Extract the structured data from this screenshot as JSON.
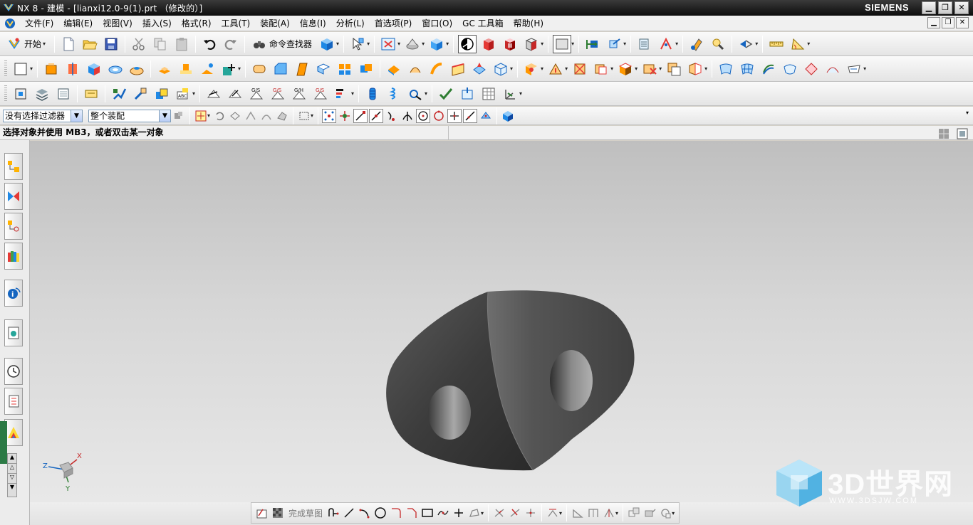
{
  "window": {
    "title": "NX 8 - 建模 - [lianxi12.0-9(1).prt （修改的）]",
    "brand": "SIEMENS",
    "controls": [
      "minimize",
      "restore",
      "close"
    ]
  },
  "menu": {
    "items": [
      "文件(F)",
      "编辑(E)",
      "视图(V)",
      "插入(S)",
      "格式(R)",
      "工具(T)",
      "装配(A)",
      "信息(I)",
      "分析(L)",
      "首选项(P)",
      "窗口(O)",
      "GC 工具箱",
      "帮助(H)"
    ]
  },
  "toolbar_standard": {
    "start_label": "开始",
    "command_finder_label": "命令查找器"
  },
  "selection_bar": {
    "filter_value": "没有选择过滤器",
    "scope_value": "整个装配"
  },
  "cue_line": {
    "text": "选择对象并使用 MB3，或者双击某一对象"
  },
  "sketch_toolbar": {
    "finish_sketch_label": "完成草图"
  },
  "triad": {
    "x_label": "X",
    "y_label": "Y",
    "z_label": "Z"
  },
  "watermark": {
    "text": "3D世界网",
    "url": "WWW.3DSJW.COM"
  },
  "colors": {
    "titlebar": "#1a1a1a",
    "part_shade_dark": "#3a3a3a",
    "part_shade_light": "#8a8a8a",
    "watermark_blue": "#4fb3e8"
  }
}
